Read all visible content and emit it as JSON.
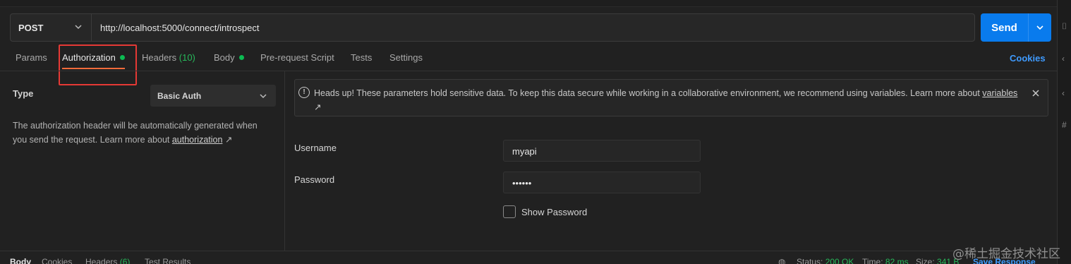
{
  "request": {
    "method": "POST",
    "url": "http://localhost:5000/connect/introspect",
    "send_label": "Send"
  },
  "tabs": [
    {
      "label": "Params"
    },
    {
      "label": "Authorization"
    },
    {
      "label": "Headers",
      "count": "(10)"
    },
    {
      "label": "Body"
    },
    {
      "label": "Pre-request Script"
    },
    {
      "label": "Tests"
    },
    {
      "label": "Settings"
    }
  ],
  "cookies_link": "Cookies",
  "auth": {
    "type_label": "Type",
    "type_value": "Basic Auth",
    "description": "The authorization header will be automatically generated when you send the request. Learn more about ",
    "description_link": "authorization",
    "link_arrow": "↗"
  },
  "alert": {
    "message": "Heads up! These parameters hold sensitive data. To keep this data secure while working in a collaborative environment, we recommend using variables. Learn more about ",
    "link": "variables",
    "arrow": "↗"
  },
  "form": {
    "username_label": "Username",
    "username_value": "myapi",
    "password_label": "Password",
    "password_value": "••••••",
    "show_password_label": "Show Password"
  },
  "bottom": {
    "body": "Body",
    "cookies": "Cookies",
    "headers": "Headers",
    "headers_count": "(6)",
    "test_results": "Test Results",
    "status_label": "Status:",
    "status_value": "200 OK",
    "time_label": "Time:",
    "time_value": "82 ms",
    "size_label": "Size:",
    "size_value": "341 B",
    "save_response": "Save Response"
  },
  "watermark": "@稀土掘金技术社区"
}
